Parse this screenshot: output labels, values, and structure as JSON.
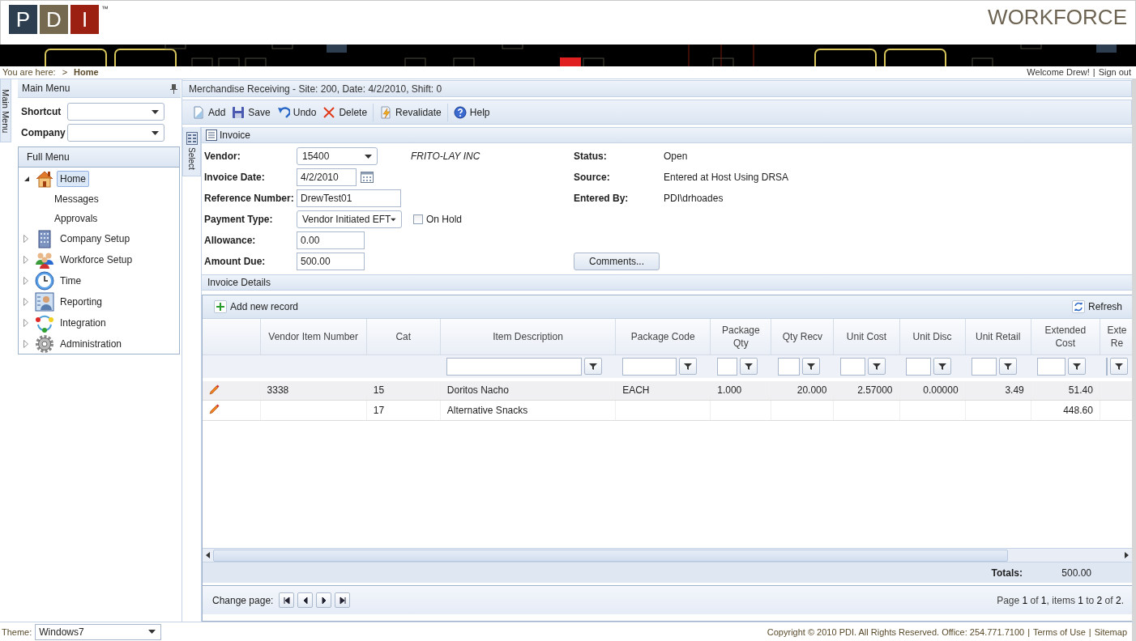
{
  "header": {
    "logo": {
      "letters": [
        "P",
        "D",
        "I"
      ],
      "trademark": "™"
    },
    "app_title": "WORKFORCE"
  },
  "breadcrumb": {
    "label": "You are here:",
    "separator": ">",
    "current": "Home"
  },
  "user": {
    "welcome": "Welcome Drew!",
    "separator": "|",
    "sign_out": "Sign out"
  },
  "sidebar": {
    "tab": "Main Menu",
    "title": "Main Menu",
    "fields": [
      {
        "label": "Shortcut"
      },
      {
        "label": "Company"
      }
    ],
    "full_menu": {
      "title": "Full Menu",
      "items": [
        {
          "label": "Home",
          "selected": true,
          "expanded": true,
          "children": [
            {
              "label": "Messages",
              "selected": false
            },
            {
              "label": "Approvals",
              "selected": false
            }
          ]
        },
        {
          "label": "Company Setup",
          "selected": false,
          "expanded": false
        },
        {
          "label": "Workforce Setup",
          "selected": false,
          "expanded": false
        },
        {
          "label": "Time",
          "selected": false,
          "expanded": false
        },
        {
          "label": "Reporting",
          "selected": false,
          "expanded": false
        },
        {
          "label": "Integration",
          "selected": false,
          "expanded": false
        },
        {
          "label": "Administration",
          "selected": false,
          "expanded": false
        }
      ]
    }
  },
  "select_tab": "Select",
  "page_title": "Merchandise Receiving - Site: 200, Date: 4/2/2010, Shift: 0",
  "toolbar": [
    [
      {
        "label": "Add",
        "kind": "add"
      },
      {
        "label": "Save",
        "kind": "save"
      },
      {
        "label": "Undo",
        "kind": "undo"
      },
      {
        "label": "Delete",
        "kind": "delete"
      }
    ],
    [
      {
        "label": "Revalidate",
        "kind": "revalidate"
      }
    ],
    [
      {
        "label": "Help",
        "kind": "help"
      }
    ]
  ],
  "invoice": {
    "title": "Invoice",
    "fields": [
      {
        "kind": "select",
        "label": "Vendor:",
        "value": "15400"
      },
      {
        "kind": "date",
        "label": "Invoice Date:",
        "value": "4/2/2010"
      },
      {
        "kind": "text",
        "label": "Reference Number:",
        "value": "DrewTest01"
      },
      {
        "kind": "select",
        "label": "Payment Type:",
        "value": "Vendor Initiated EFT"
      },
      {
        "kind": "text",
        "label": "Allowance:",
        "value": "0.00"
      },
      {
        "kind": "text",
        "label": "Amount Due:",
        "value": "500.00"
      }
    ],
    "vendor_name": "FRITO-LAY INC",
    "on_hold": {
      "label": "On Hold",
      "checked": false
    },
    "info": [
      {
        "label": "Status:",
        "value": "Open"
      },
      {
        "label": "Source:",
        "value": "Entered at Host Using DRSA"
      },
      {
        "label": "Entered By:",
        "value": "PDI\\drhoades"
      }
    ],
    "comments_button": "Comments..."
  },
  "invoice_details": {
    "title": "Invoice Details",
    "add_button": "Add new record",
    "refresh_button": "Refresh",
    "columns": [
      {
        "label": "Vendor Item Number",
        "filter": false
      },
      {
        "label": "Cat",
        "filter": false
      },
      {
        "label": "Item Description",
        "filter": true
      },
      {
        "label": "Package Code",
        "filter": true
      },
      {
        "label": "Package Qty",
        "filter": true
      },
      {
        "label": "Qty Recv",
        "filter": true
      },
      {
        "label": "Unit Cost",
        "filter": true
      },
      {
        "label": "Unit Disc",
        "filter": true
      },
      {
        "label": "Unit Retail",
        "filter": true
      },
      {
        "label": "Extended Cost",
        "filter": true
      },
      {
        "label": "Exte Re",
        "filter": true
      }
    ],
    "rows": [
      {
        "cells": [
          "3338",
          "15",
          "Doritos Nacho",
          "EACH",
          "1.000",
          "20.000",
          "2.57000",
          "0.00000",
          "3.49",
          "51.40",
          null
        ]
      },
      {
        "cells": [
          null,
          "17",
          "Alternative Snacks",
          null,
          null,
          null,
          null,
          null,
          null,
          "448.60",
          null
        ]
      }
    ],
    "totals": {
      "label": "Totals:",
      "value": "500.00"
    },
    "pager": {
      "label": "Change page:",
      "summary": "Page **1** of **1**, items **1** to **2** of **2**."
    }
  },
  "footer": {
    "theme": {
      "label": "Theme:",
      "value": "Windows7"
    },
    "copyright": "Copyright © 2010 PDI. All Rights Reserved. Office: 254.771.7100",
    "links": [
      "Terms of Use",
      "Sitemap"
    ],
    "separator": "|"
  }
}
